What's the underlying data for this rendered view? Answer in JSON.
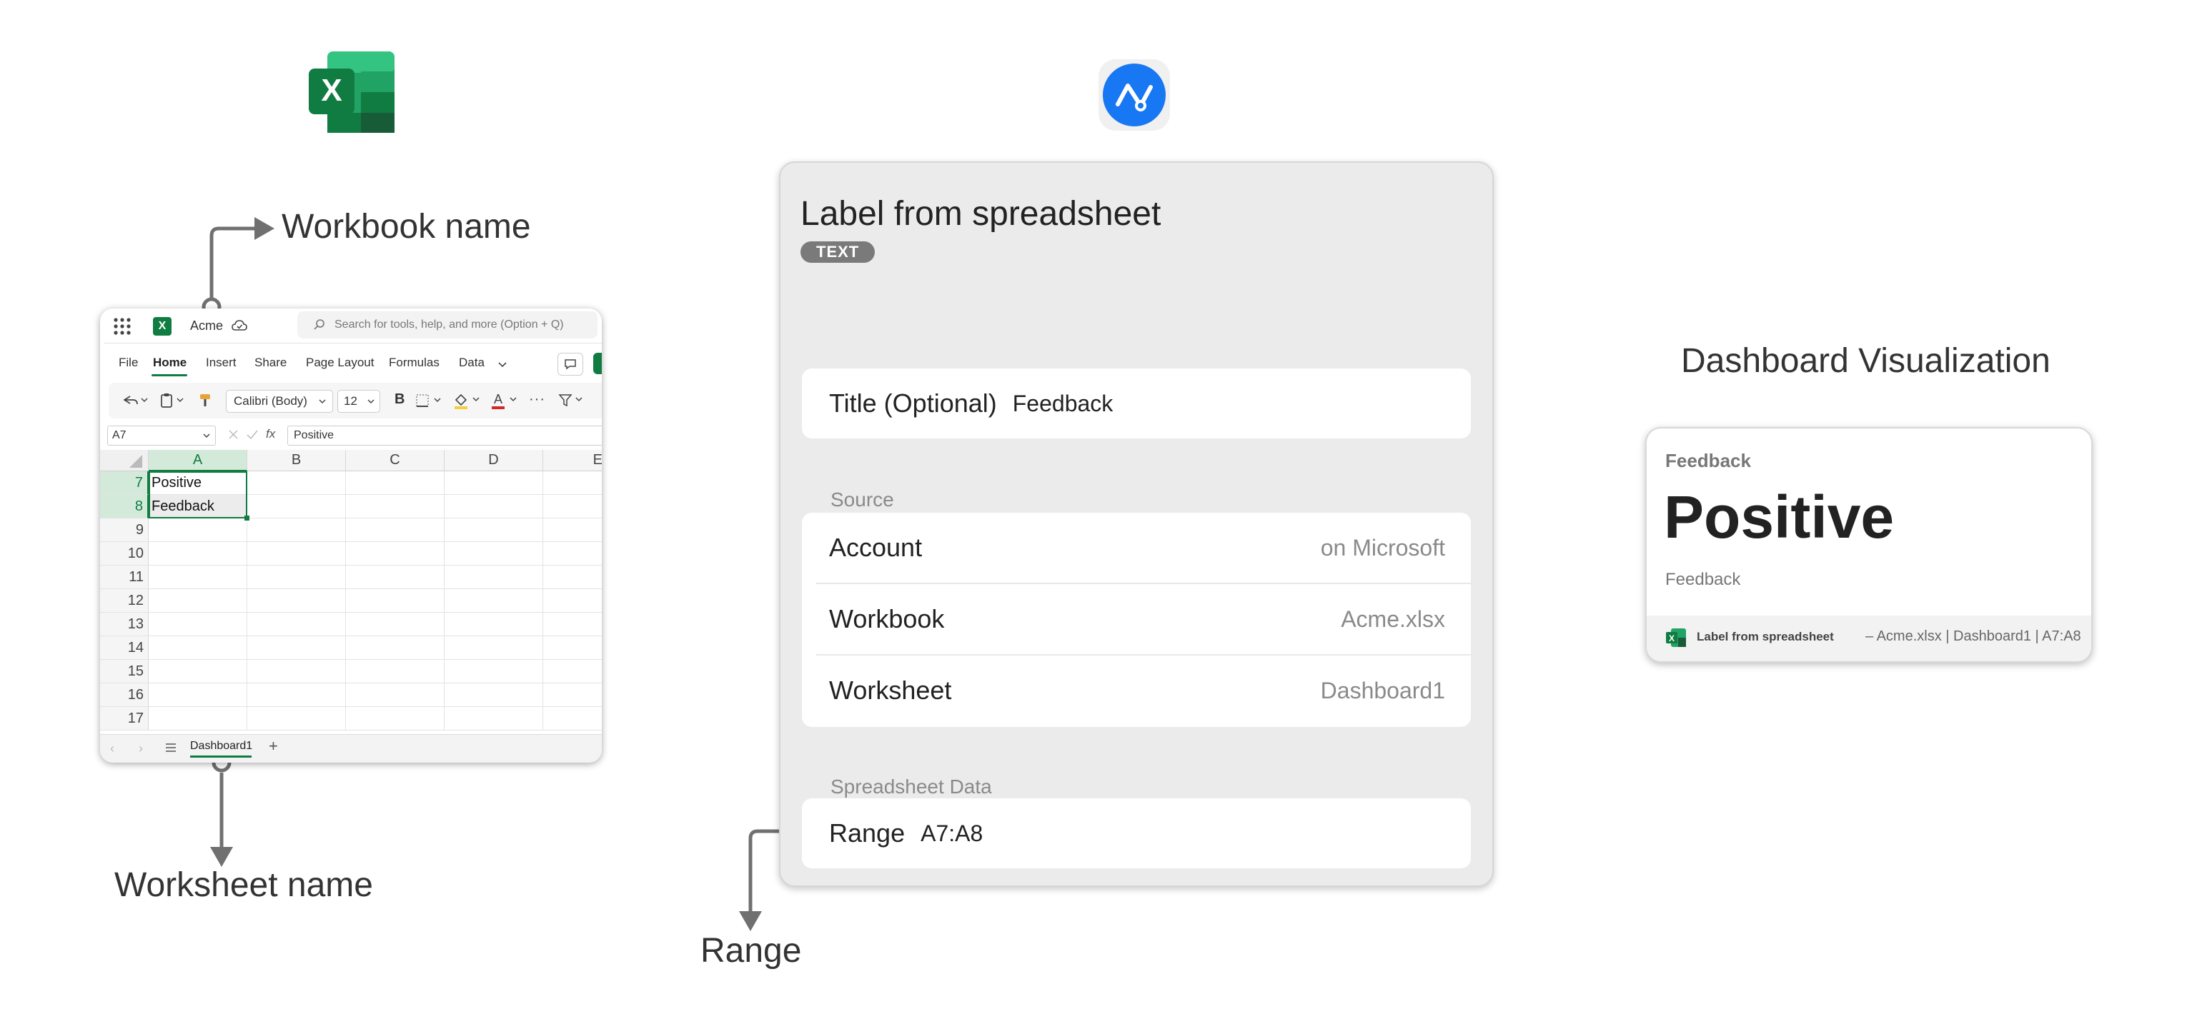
{
  "top_icons": {
    "excel": "excel-app-icon",
    "app": "graph-app-icon"
  },
  "callouts": {
    "workbook_name": "Workbook name",
    "worksheet_name": "Worksheet name",
    "range": "Range",
    "dashboard_visualization": "Dashboard Visualization"
  },
  "excel": {
    "title": "Acme",
    "search_placeholder": "Search for tools, help, and more (Option + Q)",
    "tabs": [
      "File",
      "Home",
      "Insert",
      "Share",
      "Page Layout",
      "Formulas",
      "Data"
    ],
    "font_name": "Calibri (Body)",
    "font_size": "12",
    "bold_label": "B",
    "name_box": "A7",
    "formula_value": "Positive",
    "fx_label": "fx",
    "columns": [
      "A",
      "B",
      "C",
      "D",
      "E"
    ],
    "rows": [
      "7",
      "8",
      "9",
      "10",
      "11",
      "12",
      "13",
      "14",
      "15",
      "16",
      "17"
    ],
    "cells": {
      "A7": "Positive",
      "A8": "Feedback"
    },
    "sheet_tab": "Dashboard1",
    "add_sheet": "+"
  },
  "panel": {
    "title": "Label from spreadsheet",
    "type_pill": "TEXT",
    "title_field_label": "Title (Optional)",
    "title_field_value": "Feedback",
    "source_header": "Source",
    "source_rows": [
      {
        "label": "Account",
        "value": "on Microsoft"
      },
      {
        "label": "Workbook",
        "value": "Acme.xlsx"
      },
      {
        "label": "Worksheet",
        "value": "Dashboard1"
      }
    ],
    "data_header": "Spreadsheet Data",
    "range_label": "Range",
    "range_value": "A7:A8"
  },
  "widget": {
    "title": "Feedback",
    "value": "Positive",
    "caption": "Feedback",
    "footer_name": "Label from spreadsheet",
    "footer_detail": "– Acme.xlsx | Dashboard1 | A7:A8"
  },
  "colors": {
    "excel_green": "#107c41",
    "app_blue": "#1877f2",
    "connector": "#707070"
  }
}
